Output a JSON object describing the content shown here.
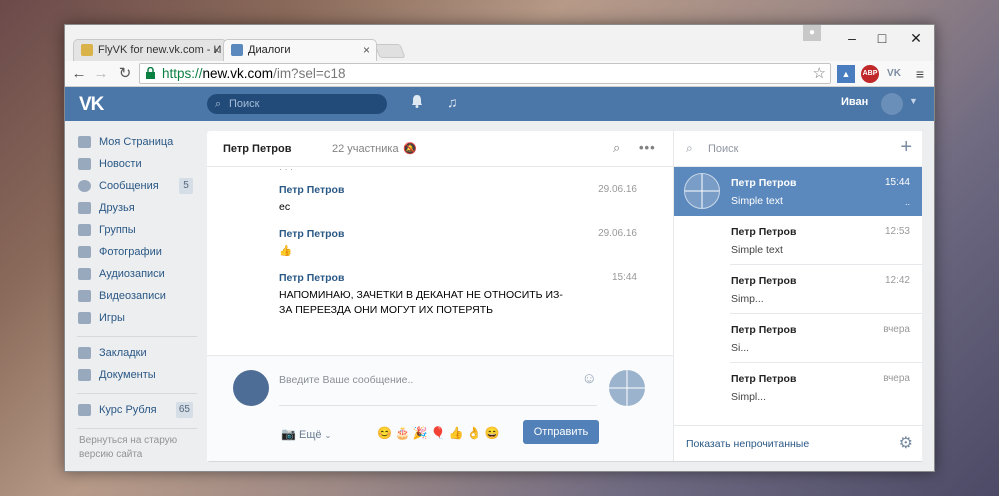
{
  "browser": {
    "tabs": [
      {
        "label": "FlyVK for new.vk.com - И"
      },
      {
        "label": "Диалоги"
      }
    ],
    "url_scheme": "https://",
    "url_host": "new.vk.com",
    "url_path": "/im?sel=c18",
    "ext_abp": "ABP"
  },
  "vk": {
    "logo": "VK",
    "search_placeholder": "Поиск",
    "user_name": "Иван"
  },
  "nav": {
    "items": [
      {
        "label": "Моя Страница",
        "count": ""
      },
      {
        "label": "Новости",
        "count": ""
      },
      {
        "label": "Сообщения",
        "count": "5"
      },
      {
        "label": "Друзья",
        "count": ""
      },
      {
        "label": "Группы",
        "count": ""
      },
      {
        "label": "Фотографии",
        "count": ""
      },
      {
        "label": "Аудиозаписи",
        "count": ""
      },
      {
        "label": "Видеозаписи",
        "count": ""
      },
      {
        "label": "Игры",
        "count": ""
      }
    ],
    "items2": [
      {
        "label": "Закладки"
      },
      {
        "label": "Документы"
      }
    ],
    "rate": {
      "label": "Курс Рубля",
      "count": "65"
    },
    "footer": "Вернуться на старую версию сайта"
  },
  "chat": {
    "title": "Петр Петров",
    "members": "22 участника",
    "messages": [
      {
        "name": "Петр Петров",
        "time": "29.06.16",
        "text": "ес"
      },
      {
        "name": "Петр Петров",
        "time": "29.06.16",
        "text": "👍"
      },
      {
        "name": "Петр Петров",
        "time": "15:44",
        "text": "НАПОМИНАЮ, ЗАЧЕТКИ В ДЕКАНАТ НЕ ОТНОСИТЬ ИЗ-ЗА ПЕРЕЕЗДА ОНИ МОГУТ ИХ ПОТЕРЯТЬ"
      }
    ],
    "composer_placeholder": "Введите Ваше сообщение..",
    "more_label": "Ещё",
    "emojis": "😊🎂🎉🎈👍👌😄",
    "send_label": "Отправить"
  },
  "dialogs": {
    "search_placeholder": "Поиск",
    "items": [
      {
        "name": "Петр Петров",
        "time": "15:44",
        "text": "Simple text"
      },
      {
        "name": "Петр Петров",
        "time": "12:53",
        "text": "Simple text"
      },
      {
        "name": "Петр Петров",
        "time": "12:42",
        "text": "Simp..."
      },
      {
        "name": "Петр Петров",
        "time": "вчера",
        "text": "Si..."
      },
      {
        "name": "Петр Петров",
        "time": "вчера",
        "text": "Simpl..."
      }
    ],
    "show_unread": "Показать непрочитанные"
  },
  "colors": {
    "vk_blue": "#4a76a8",
    "selected_dialog": "#5b88bd",
    "send_button": "#5181b8"
  }
}
